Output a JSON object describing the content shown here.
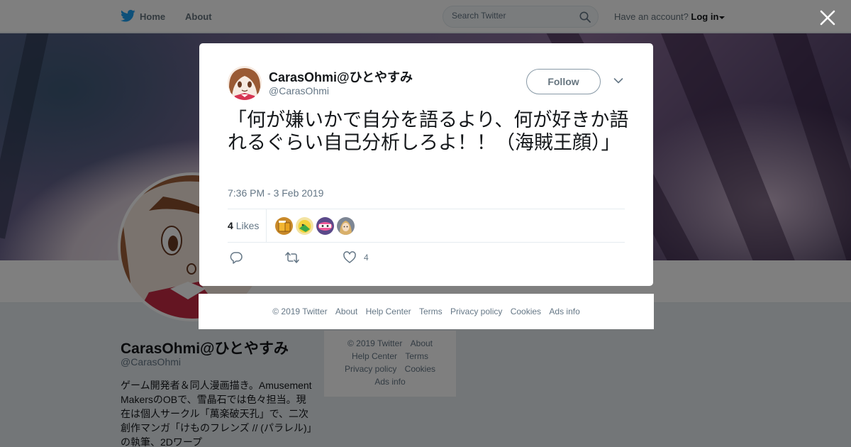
{
  "nav": {
    "home_label": "Home",
    "about_label": "About",
    "search_placeholder": "Search Twitter",
    "account_prompt": "Have an account?",
    "login_label": "Log in"
  },
  "profile": {
    "name": "CarasOhmi@ひとやすみ",
    "handle": "@CarasOhmi",
    "bio": "ゲーム開発者＆同人漫画描き。Amusement MakersのOBで、雪晶石では色々担当。現在は個人サークル「萬楽破天孔」で、二次創作マンガ「けものフレンズ // (パラレル)」の執筆、2Dワープ"
  },
  "side_footer": {
    "copyright": "© 2019 Twitter",
    "about": "About",
    "help": "Help Center",
    "terms": "Terms",
    "privacy": "Privacy policy",
    "cookies": "Cookies",
    "ads": "Ads info"
  },
  "tweet": {
    "author_name": "CarasOhmi@ひとやすみ",
    "author_handle": "@CarasOhmi",
    "follow_label": "Follow",
    "text": "「何が嫌いかで自分を語るより、何が好きか語れるぐらい自己分析しろよ！！（海賊王顔）」",
    "timestamp": "7:36 PM - 3 Feb 2019",
    "likes_count": "4",
    "likes_label": "Likes",
    "like_action_count": "4",
    "liker_avatars": [
      "beer-avatar",
      "yellow-character-avatar",
      "pink-character-avatar",
      "gray-character-avatar"
    ]
  },
  "modal_footer": {
    "copyright": "© 2019 Twitter",
    "about": "About",
    "help": "Help Center",
    "terms": "Terms",
    "privacy": "Privacy policy",
    "cookies": "Cookies",
    "ads": "Ads info"
  },
  "colors": {
    "twitter_blue": "#1da1f2",
    "text_primary": "#14171a",
    "text_secondary": "#657786",
    "overlay": "rgba(0,0,0,0.5)"
  }
}
